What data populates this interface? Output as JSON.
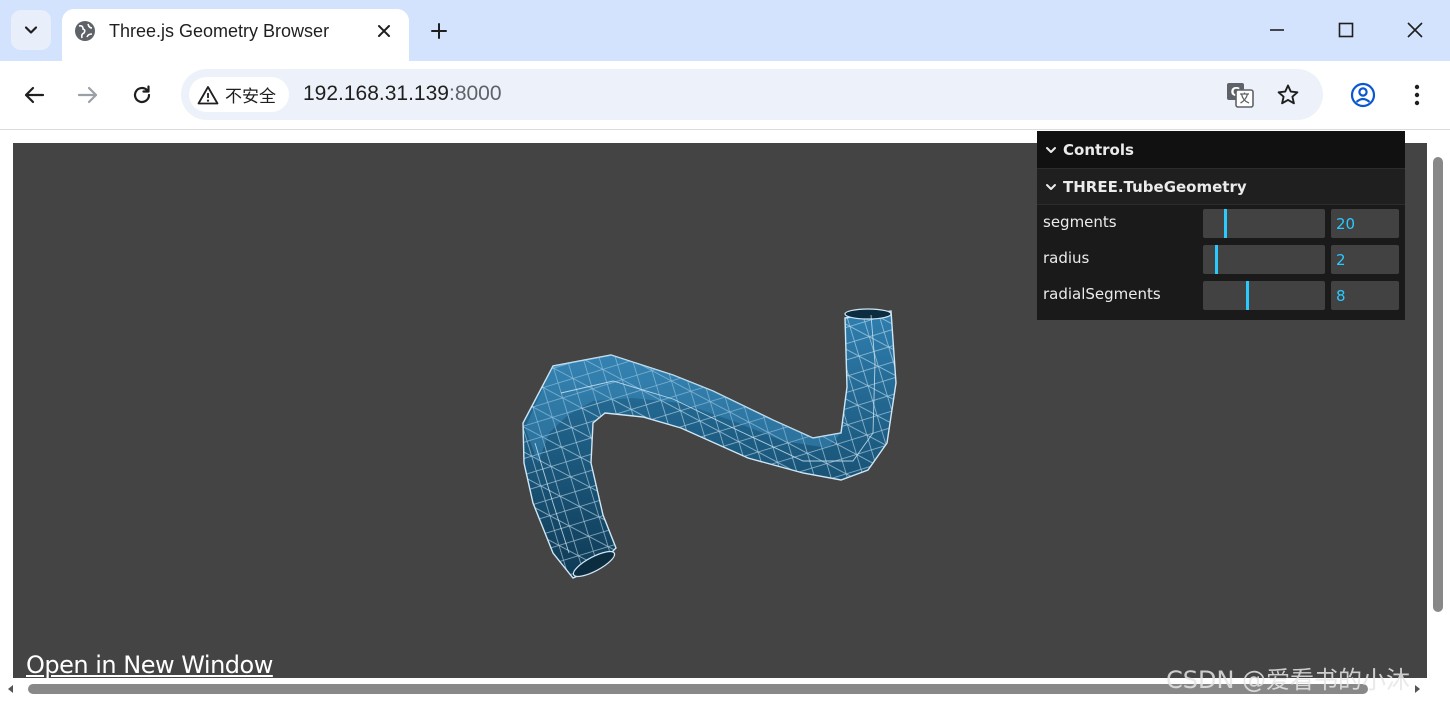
{
  "browser": {
    "tab_title": "Three.js Geometry Browser",
    "security_label": "不安全",
    "url_host": "192.168.31.139",
    "url_port": ":8000"
  },
  "gui": {
    "title": "Controls",
    "folder": "THREE.TubeGeometry",
    "params": [
      {
        "label": "segments",
        "value": "20",
        "level": 0.18
      },
      {
        "label": "radius",
        "value": "2",
        "level": 0.1
      },
      {
        "label": "radialSegments",
        "value": "8",
        "level": 0.36
      }
    ]
  },
  "page": {
    "open_link": "Open in New Window"
  },
  "watermark": "CSDN @爱看书的小沐",
  "colors": {
    "canvas_bg": "#444444",
    "gui_accent": "#2cc9ff",
    "tab_strip": "#d3e3fd",
    "mesh_color": "#1f5f85"
  },
  "icons": [
    "chevron-down-icon",
    "globe-icon",
    "close-icon",
    "plus-icon",
    "minimize-icon",
    "maximize-icon",
    "back-icon",
    "forward-icon",
    "reload-icon",
    "warning-icon",
    "translate-icon",
    "star-icon",
    "profile-icon",
    "kebab-menu-icon"
  ]
}
